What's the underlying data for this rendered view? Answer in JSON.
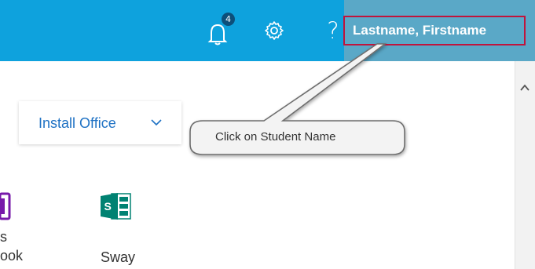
{
  "header": {
    "background_color": "#0ea2dd",
    "notifications": {
      "icon": "bell-icon",
      "count": "4"
    },
    "settings": {
      "icon": "gear-icon"
    },
    "help": {
      "icon": "help-icon",
      "label": "?"
    },
    "user": {
      "name": "Lastname, Firstname"
    },
    "highlight_color": "#c0143c"
  },
  "main": {
    "install_button": {
      "label": "Install Office",
      "icon": "chevron-down-icon",
      "color": "#1f72c4"
    },
    "apps": [
      {
        "label": "s\nook",
        "icon": "onenote-icon",
        "color": "#7719aa"
      },
      {
        "label": "Sway",
        "icon": "sway-icon",
        "color": "#008272"
      }
    ]
  },
  "annotation": {
    "callout_text": "Click on Student Name"
  },
  "scrollbar": {
    "icon": "chevron-up-icon"
  }
}
